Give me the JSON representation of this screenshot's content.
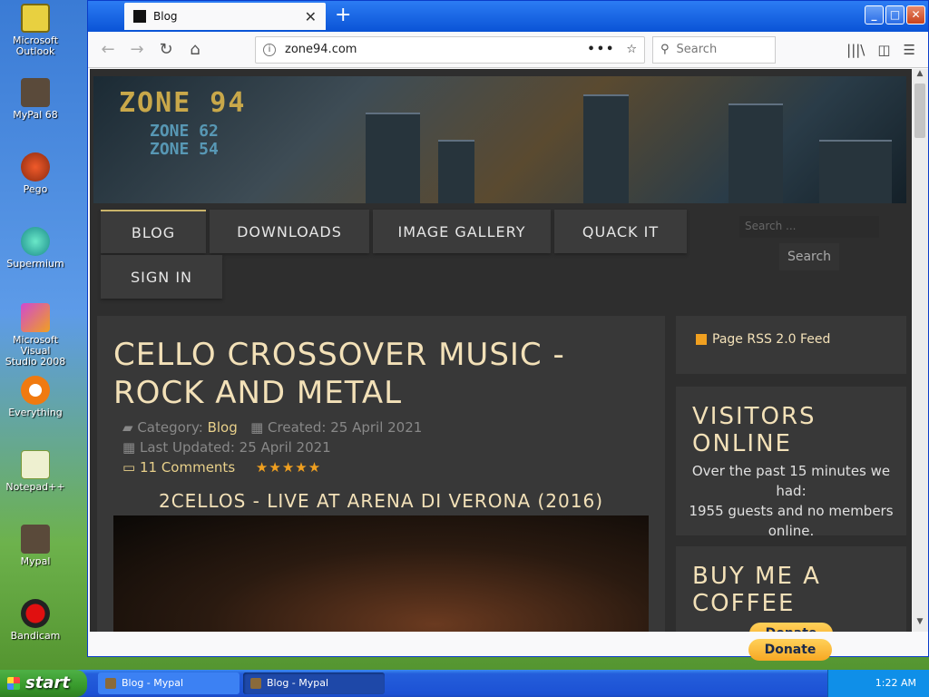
{
  "desktop_icons": [
    {
      "label": "Microsoft Outlook",
      "icon": "outlook-icon"
    },
    {
      "label": "MyPal 68",
      "icon": "mypal-icon"
    },
    {
      "label": "Pego",
      "icon": "pego-icon"
    },
    {
      "label": "Supermium",
      "icon": "supermium-icon"
    },
    {
      "label": "Microsoft Visual Studio 2008",
      "icon": "visual-studio-icon"
    },
    {
      "label": "Everything",
      "icon": "everything-icon"
    },
    {
      "label": "Notepad++",
      "icon": "notepad-icon"
    },
    {
      "label": "Mypal",
      "icon": "mypal-icon"
    },
    {
      "label": "Bandicam",
      "icon": "bandicam-icon"
    }
  ],
  "browser": {
    "tab_title": "Blog",
    "new_tab": "+",
    "url": "zone94.com",
    "search_placeholder": "Search"
  },
  "site": {
    "logo_main": "ZONE 94",
    "logo_sub1": "ZONE 62",
    "logo_sub2": "ZONE 54",
    "menu": [
      "BLOG",
      "DOWNLOADS",
      "IMAGE GALLERY",
      "QUACK IT",
      "SIGN IN"
    ],
    "search_placeholder": "Search ...",
    "search_button": "Search"
  },
  "article": {
    "title": "CELLO CROSSOVER MUSIC - ROCK AND METAL",
    "category_label": "Category:",
    "category": "Blog",
    "created": "Created: 25 April 2021",
    "updated": "Last Updated: 25 April 2021",
    "comments": "11 Comments",
    "stars": "★★★★★",
    "subtitle": "2CELLOS - LIVE AT ARENA DI VERONA (2016)"
  },
  "sidebar": {
    "rss": "Page RSS 2.0 Feed",
    "visitors_title": "VISITORS ONLINE",
    "visitors_line1": "Over the past 15 minutes we had:",
    "visitors_line2": "1955 guests and no members online.",
    "coffee_title": "BUY ME A COFFEE",
    "donate": "Donate"
  },
  "taskbar": {
    "start": "start",
    "tasks": [
      "Blog - Mypal",
      "Blog - Mypal"
    ],
    "clock": "1:22 AM"
  },
  "colors": {
    "accent_text": "#f3e1b8",
    "link": "#e8d08a",
    "star": "#f0a020"
  }
}
